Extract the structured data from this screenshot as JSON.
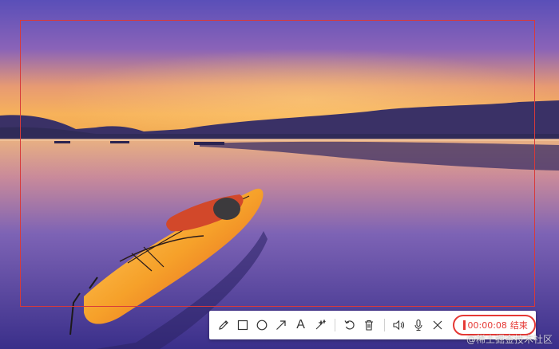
{
  "toolbar": {
    "tools": [
      {
        "icon": "pencil-icon"
      },
      {
        "icon": "rectangle-icon"
      },
      {
        "icon": "circle-icon"
      },
      {
        "icon": "arrow-icon"
      },
      {
        "icon": "text-icon",
        "glyph": "A"
      },
      {
        "icon": "magic-wand-icon"
      },
      {
        "icon": "undo-icon"
      },
      {
        "icon": "trash-icon"
      },
      {
        "icon": "speaker-icon"
      },
      {
        "icon": "microphone-icon"
      },
      {
        "icon": "close-icon"
      }
    ],
    "recording": {
      "time": "00:00:08",
      "end_label": "结束"
    }
  },
  "watermark": "@稀土掘金技术社区",
  "colors": {
    "selection": "#d83a3a",
    "record": "#e53935",
    "icon": "#333333"
  }
}
